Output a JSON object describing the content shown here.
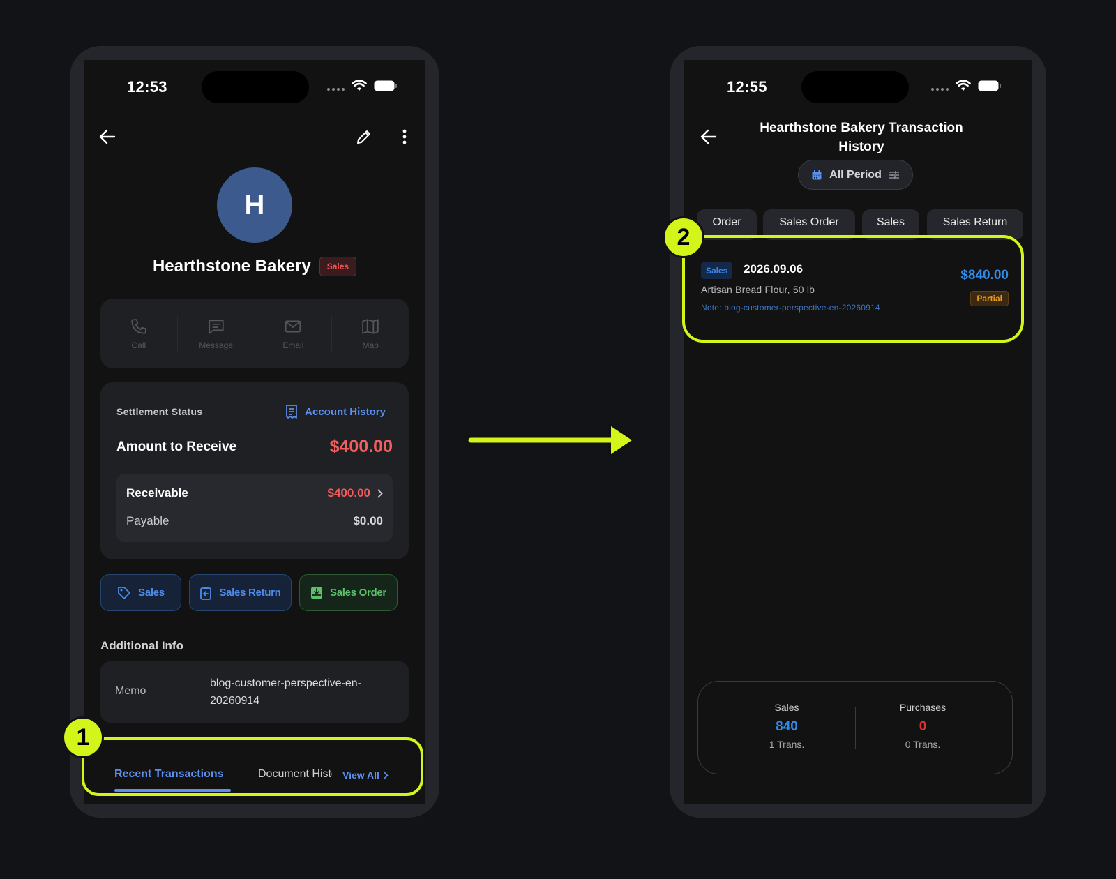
{
  "left_phone": {
    "status_time": "12:53",
    "customer_initial": "H",
    "customer_name": "Hearthstone Bakery",
    "customer_type_badge": "Sales",
    "contact_actions": [
      "Call",
      "Message",
      "Email",
      "Map"
    ],
    "settlement": {
      "label": "Settlement Status",
      "account_history_link": "Account History",
      "amount_label": "Amount to Receive",
      "amount_value": "$400.00",
      "receivable_label": "Receivable",
      "receivable_value": "$400.00",
      "payable_label": "Payable",
      "payable_value": "$0.00"
    },
    "actions": {
      "sales": "Sales",
      "sales_return": "Sales Return",
      "sales_order": "Sales Order"
    },
    "additional_info": {
      "title": "Additional Info",
      "memo_label": "Memo",
      "memo_value": "blog-customer-perspective-en-20260914"
    },
    "tabs": {
      "recent": "Recent Transactions",
      "document": "Document History",
      "view_all": "View All"
    }
  },
  "right_phone": {
    "status_time": "12:55",
    "title": "Hearthstone Bakery Transaction History",
    "period": "All Period",
    "filter_chips": [
      "Order",
      "Sales Order",
      "Sales",
      "Sales Return"
    ],
    "transaction": {
      "type_badge": "Sales",
      "date": "2026.09.06",
      "item": "Artisan Bread Flour, 50 lb",
      "note": "Note: blog-customer-perspective-en-20260914",
      "amount": "$840.00",
      "status": "Partial"
    },
    "summary": {
      "sales_label": "Sales",
      "sales_value": "840",
      "sales_count": "1 Trans.",
      "purchases_label": "Purchases",
      "purchases_value": "0",
      "purchases_count": "0 Trans."
    }
  },
  "annotations": {
    "step1": "1",
    "step2": "2"
  },
  "colors": {
    "highlight": "#d4f51a",
    "accent_blue": "#5b8ff0",
    "negative_red": "#f35d5d",
    "sales_green": "#5bc06a",
    "partial_orange": "#e89a1e"
  }
}
